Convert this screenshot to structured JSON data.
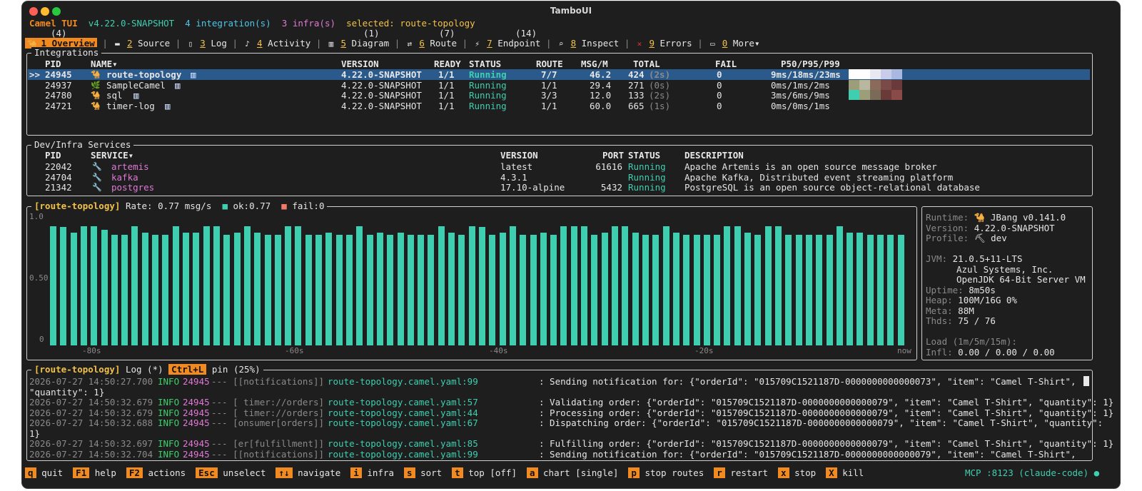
{
  "window": {
    "title": "TamboUI"
  },
  "header": {
    "app": "Camel TUI",
    "version": "v4.22.0-SNAPSHOT",
    "integrations": "4 integration(s)",
    "infra": "3 infra(s)",
    "selected": "selected: route-topology"
  },
  "tabs": [
    {
      "count": "(4)",
      "num": "1",
      "label": "Overview",
      "icon": "camel-icon",
      "active": true
    },
    {
      "count": "",
      "num": "2",
      "label": "Source",
      "icon": "monitor-icon"
    },
    {
      "count": "",
      "num": "3",
      "label": "Log",
      "icon": "page-icon"
    },
    {
      "count": "",
      "num": "4",
      "label": "Activity",
      "icon": "bell-icon"
    },
    {
      "count": "(1)",
      "num": "5",
      "label": "Diagram",
      "icon": "chart-icon"
    },
    {
      "count": "(7)",
      "num": "6",
      "label": "Route",
      "icon": "route-icon"
    },
    {
      "count": "(14)",
      "num": "7",
      "label": "Endpoint",
      "icon": "plug-icon"
    },
    {
      "count": "",
      "num": "8",
      "label": "Inspect",
      "icon": "magnifier-icon"
    },
    {
      "count": "",
      "num": "9",
      "label": "Errors",
      "icon": "cross-icon"
    },
    {
      "count": "",
      "num": "0",
      "label": "More▾",
      "icon": "folder-icon"
    }
  ],
  "integrations": {
    "title": "Integrations",
    "columns": [
      "PID",
      "NAME▾",
      "VERSION",
      "READY",
      "STATUS",
      "ROUTE",
      "MSG/M",
      "TOTAL",
      "FAIL",
      "P50/P95/P99"
    ],
    "rows": [
      {
        "marker": ">>",
        "pid": "24945",
        "name": "route-topology",
        "version": "4.22.0-SNAPSHOT",
        "ready": "1/1",
        "status": "Running",
        "route": "7/7",
        "msgm": "46.2",
        "total": "424",
        "age": "(2s)",
        "fail": "0",
        "pct": "9ms/18ms/23ms",
        "selected": true
      },
      {
        "marker": "",
        "pid": "24937",
        "name": "SampleCamel",
        "version": "4.22.0-SNAPSHOT",
        "ready": "1/1",
        "status": "Running",
        "route": "1/1",
        "msgm": "29.4",
        "total": "271",
        "age": "(0s)",
        "fail": "0",
        "pct": "0ms/1ms/2ms"
      },
      {
        "marker": "",
        "pid": "24780",
        "name": "sql",
        "version": "4.22.0-SNAPSHOT",
        "ready": "1/1",
        "status": "Running",
        "route": "3/3",
        "msgm": "12.0",
        "total": "133",
        "age": "(2s)",
        "fail": "0",
        "pct": "3ms/6ms/9ms"
      },
      {
        "marker": "",
        "pid": "24721",
        "name": "timer-log",
        "version": "4.22.0-SNAPSHOT",
        "ready": "1/1",
        "status": "Running",
        "route": "1/1",
        "msgm": "60.0",
        "total": "665",
        "age": "(1s)",
        "fail": "0",
        "pct": "0ms/0ms/1ms"
      }
    ]
  },
  "infra": {
    "title": "Dev/Infra Services",
    "columns": [
      "PID",
      "SERVICE▾",
      "VERSION",
      "PORT",
      "STATUS",
      "DESCRIPTION"
    ],
    "rows": [
      {
        "pid": "22042",
        "service": "artemis",
        "version": "latest",
        "port": "61616",
        "status": "Running",
        "desc": "Apache Artemis is an open source message broker"
      },
      {
        "pid": "24704",
        "service": "kafka",
        "version": "4.3.1",
        "port": "",
        "status": "Running",
        "desc": "Apache Kafka, Distributed event streaming platform"
      },
      {
        "pid": "21342",
        "service": "postgres",
        "version": "17.10-alpine",
        "port": "5432",
        "status": "Running",
        "desc": "PostgreSQL is an open source object-relational database"
      }
    ]
  },
  "chart_panel": {
    "name": "[route-topology]",
    "rate": "Rate: 0.77 msg/s",
    "ok_marker": "■",
    "ok": "ok:0.77",
    "fail_marker": "■",
    "fail": "fail:0"
  },
  "chart_data": {
    "type": "bar",
    "ylim": [
      0,
      1.0
    ],
    "yticks": [
      "1.0",
      "0.50",
      "0"
    ],
    "xticks": [
      "-80s",
      "-60s",
      "-40s",
      "-20s",
      "now"
    ],
    "color": "#3ecfb0",
    "values": [
      0.93,
      0.92,
      0.88,
      0.93,
      0.93,
      0.9,
      0.86,
      0.86,
      0.93,
      0.88,
      0.86,
      0.86,
      0.93,
      0.88,
      0.88,
      0.93,
      0.93,
      0.86,
      0.88,
      0.93,
      0.88,
      0.86,
      0.86,
      0.93,
      0.93,
      0.86,
      0.86,
      0.88,
      0.86,
      0.86,
      0.93,
      0.86,
      0.88,
      0.86,
      0.88,
      0.86,
      0.86,
      0.86,
      0.93,
      0.88,
      0.86,
      0.93,
      0.92,
      0.86,
      0.88,
      0.93,
      0.86,
      0.86,
      0.88,
      0.86,
      0.93,
      0.93,
      0.93,
      0.86,
      0.88,
      0.93,
      0.93,
      0.88,
      0.86,
      0.86,
      0.93,
      0.88,
      0.86,
      0.86,
      0.86,
      0.86,
      0.93,
      0.93,
      0.88,
      0.86,
      0.93,
      0.93,
      0.86,
      0.86,
      0.86,
      0.86,
      0.86,
      0.93,
      0.88,
      0.88,
      0.86,
      0.86,
      0.86,
      0.86
    ]
  },
  "runtime": [
    {
      "label": "Runtime:",
      "value": "🐪 JBang v0.141.0"
    },
    {
      "label": "Version:",
      "value": "4.22.0-SNAPSHOT"
    },
    {
      "label": "Profile:",
      "value": "⛏ dev"
    },
    {
      "label": "",
      "value": ""
    },
    {
      "label": "JVM:",
      "value": "21.0.5+11-LTS"
    },
    {
      "label": "",
      "value": "Azul Systems, Inc."
    },
    {
      "label": "",
      "value": "OpenJDK 64-Bit Server VM"
    },
    {
      "label": "Uptime:",
      "value": "8m50s"
    },
    {
      "label": "Heap:",
      "value": "100M/16G 0%"
    },
    {
      "label": "Meta:",
      "value": "88M"
    },
    {
      "label": "Thds:",
      "value": "75 / 76"
    },
    {
      "label": "",
      "value": ""
    },
    {
      "label": "Load (1m/5m/15m):",
      "value": ""
    },
    {
      "label": "Infl:",
      "value": "0.00 / 0.00 / 0.00"
    }
  ],
  "log_panel": {
    "name": "[route-topology]",
    "label": "Log (*)",
    "key": "Ctrl+L",
    "pin": "pin (25%)",
    "lines": [
      {
        "ts": "2026-07-27 14:50:27.700",
        "lvl": "INFO",
        "pid": "24945",
        "thread": "--- [[notifications]]",
        "src": "route-topology.camel.yaml:99",
        "msg": ": Sending notification for: {\"orderId\": \"015709C1521187D-0000000000000073\", \"item\": \"Camel T-Shirt\","
      },
      {
        "ts": "",
        "lvl": "",
        "pid": "",
        "thread": "",
        "src": "",
        "msg": "\"quantity\": 1}"
      },
      {
        "ts": "2026-07-27 14:50:32.679",
        "lvl": "INFO",
        "pid": "24945",
        "thread": "--- [ timer://orders]",
        "src": "route-topology.camel.yaml:57",
        "msg": ": Validating order: {\"orderId\": \"015709C1521187D-0000000000000079\", \"item\": \"Camel T-Shirt\", \"quantity\": 1}"
      },
      {
        "ts": "2026-07-27 14:50:32.679",
        "lvl": "INFO",
        "pid": "24945",
        "thread": "--- [ timer://orders]",
        "src": "route-topology.camel.yaml:44",
        "msg": ": Processing order: {\"orderId\": \"015709C1521187D-0000000000000079\", \"item\": \"Camel T-Shirt\", \"quantity\": 1}"
      },
      {
        "ts": "2026-07-27 14:50:32.688",
        "lvl": "INFO",
        "pid": "24945",
        "thread": "--- [onsumer[orders]]",
        "src": "route-topology.camel.yaml:67",
        "msg": ": Dispatching order: {\"orderId\": \"015709C1521187D-0000000000000079\", \"item\": \"Camel T-Shirt\", \"quantity\":"
      },
      {
        "ts": "",
        "lvl": "",
        "pid": "",
        "thread": "",
        "src": "",
        "msg": "1}"
      },
      {
        "ts": "2026-07-27 14:50:32.697",
        "lvl": "INFO",
        "pid": "24945",
        "thread": "--- [er[fulfillment]]",
        "src": "route-topology.camel.yaml:85",
        "msg": ": Fulfilling order: {\"orderId\": \"015709C1521187D-0000000000000079\", \"item\": \"Camel T-Shirt\", \"quantity\": 1}"
      },
      {
        "ts": "2026-07-27 14:50:32.704",
        "lvl": "INFO",
        "pid": "24945",
        "thread": "--- [[notifications]]",
        "src": "route-topology.camel.yaml:99",
        "msg": ": Sending notification for: {\"orderId\": \"015709C1521187D-0000000000000079\", \"item\": \"Camel T-Shirt\","
      }
    ]
  },
  "footer": {
    "keys": [
      {
        "key": "q",
        "label": "quit"
      },
      {
        "key": "F1",
        "label": "help"
      },
      {
        "key": "F2",
        "label": "actions"
      },
      {
        "key": "Esc",
        "label": "unselect"
      },
      {
        "key": "↑↓",
        "label": "navigate"
      },
      {
        "key": "i",
        "label": "infra"
      },
      {
        "key": "s",
        "label": "sort"
      },
      {
        "key": "t",
        "label": "top [off]"
      },
      {
        "key": "a",
        "label": "chart [single]"
      },
      {
        "key": "p",
        "label": "stop routes"
      },
      {
        "key": "r",
        "label": "restart"
      },
      {
        "key": "x",
        "label": "stop"
      },
      {
        "key": "X",
        "label": "kill"
      }
    ],
    "mcp": "MCP :8123 (claude-code) ●"
  },
  "colors": {
    "accent": "#f28a22",
    "teal": "#3ecfb0",
    "pink": "#e078d6",
    "selection": "#2a5a8c"
  }
}
